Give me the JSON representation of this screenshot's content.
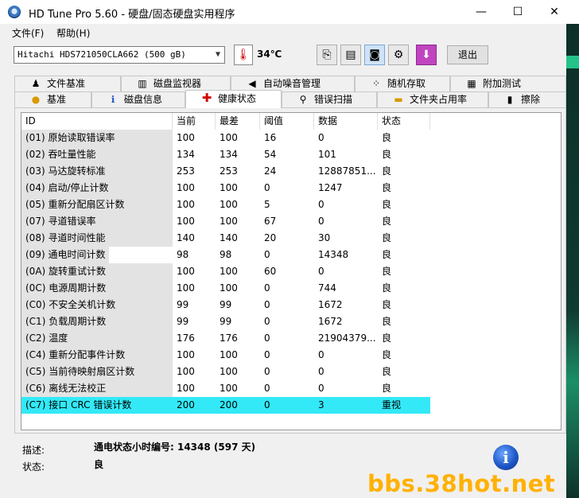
{
  "window": {
    "title": "HD Tune Pro 5.60 - 硬盘/固态硬盘实用程序",
    "min": "—",
    "max": "☐",
    "close": "✕"
  },
  "menu": {
    "file": "文件(F)",
    "help": "帮助(H)"
  },
  "toolbar": {
    "drive": "Hitachi HDS721050CLA662 (500 gB)",
    "temperature": "34℃",
    "exit": "退出",
    "icons": [
      "copy-text-icon",
      "copy-screen-icon",
      "camera-icon",
      "disk-tools-icon",
      "download-icon"
    ]
  },
  "tabs_row1": [
    "文件基准",
    "磁盘监视器",
    "自动噪音管理",
    "随机存取",
    "附加测试"
  ],
  "tabs_row2": [
    "基准",
    "磁盘信息",
    "健康状态",
    "错误扫描",
    "文件夹占用率",
    "擦除"
  ],
  "columns": [
    "ID",
    "当前",
    "最差",
    "阈值",
    "数据",
    "状态"
  ],
  "rows": [
    [
      "(01) 原始读取错误率",
      "100",
      "100",
      "16",
      "0",
      "良"
    ],
    [
      "(02) 吞吐量性能",
      "134",
      "134",
      "54",
      "101",
      "良"
    ],
    [
      "(03) 马达旋转标准",
      "253",
      "253",
      "24",
      "12887851...",
      "良"
    ],
    [
      "(04) 启动/停止计数",
      "100",
      "100",
      "0",
      "1247",
      "良"
    ],
    [
      "(05) 重新分配扇区计数",
      "100",
      "100",
      "5",
      "0",
      "良"
    ],
    [
      "(07) 寻道错误率",
      "100",
      "100",
      "67",
      "0",
      "良"
    ],
    [
      "(08) 寻道时间性能",
      "140",
      "140",
      "20",
      "30",
      "良"
    ],
    [
      "(09) 通电时间计数",
      "98",
      "98",
      "0",
      "14348",
      "良"
    ],
    [
      "(0A) 旋转重试计数",
      "100",
      "100",
      "60",
      "0",
      "良"
    ],
    [
      "(0C) 电源周期计数",
      "100",
      "100",
      "0",
      "744",
      "良"
    ],
    [
      "(C0) 不安全关机计数",
      "99",
      "99",
      "0",
      "1672",
      "良"
    ],
    [
      "(C1) 负载周期计数",
      "99",
      "99",
      "0",
      "1672",
      "良"
    ],
    [
      "(C2) 温度",
      "176",
      "176",
      "0",
      "21904379...",
      "良"
    ],
    [
      "(C4) 重新分配事件计数",
      "100",
      "100",
      "0",
      "0",
      "良"
    ],
    [
      "(C5) 当前待映射扇区计数",
      "100",
      "100",
      "0",
      "0",
      "良"
    ],
    [
      "(C6) 离线无法校正",
      "100",
      "100",
      "0",
      "0",
      "良"
    ],
    [
      "(C7) 接口 CRC 错误计数",
      "200",
      "200",
      "0",
      "3",
      "重视"
    ]
  ],
  "selected_row": 16,
  "details": {
    "desc_label": "描述:",
    "desc_value": "通电状态小时编号: 14348 (597 天)",
    "status_label": "状态:",
    "status_value": "良"
  },
  "info_glyph": "i",
  "watermark": "bbs.38hot.net",
  "colors": {
    "selected_row": "#33e9f7",
    "watermark": "#ffb100"
  }
}
